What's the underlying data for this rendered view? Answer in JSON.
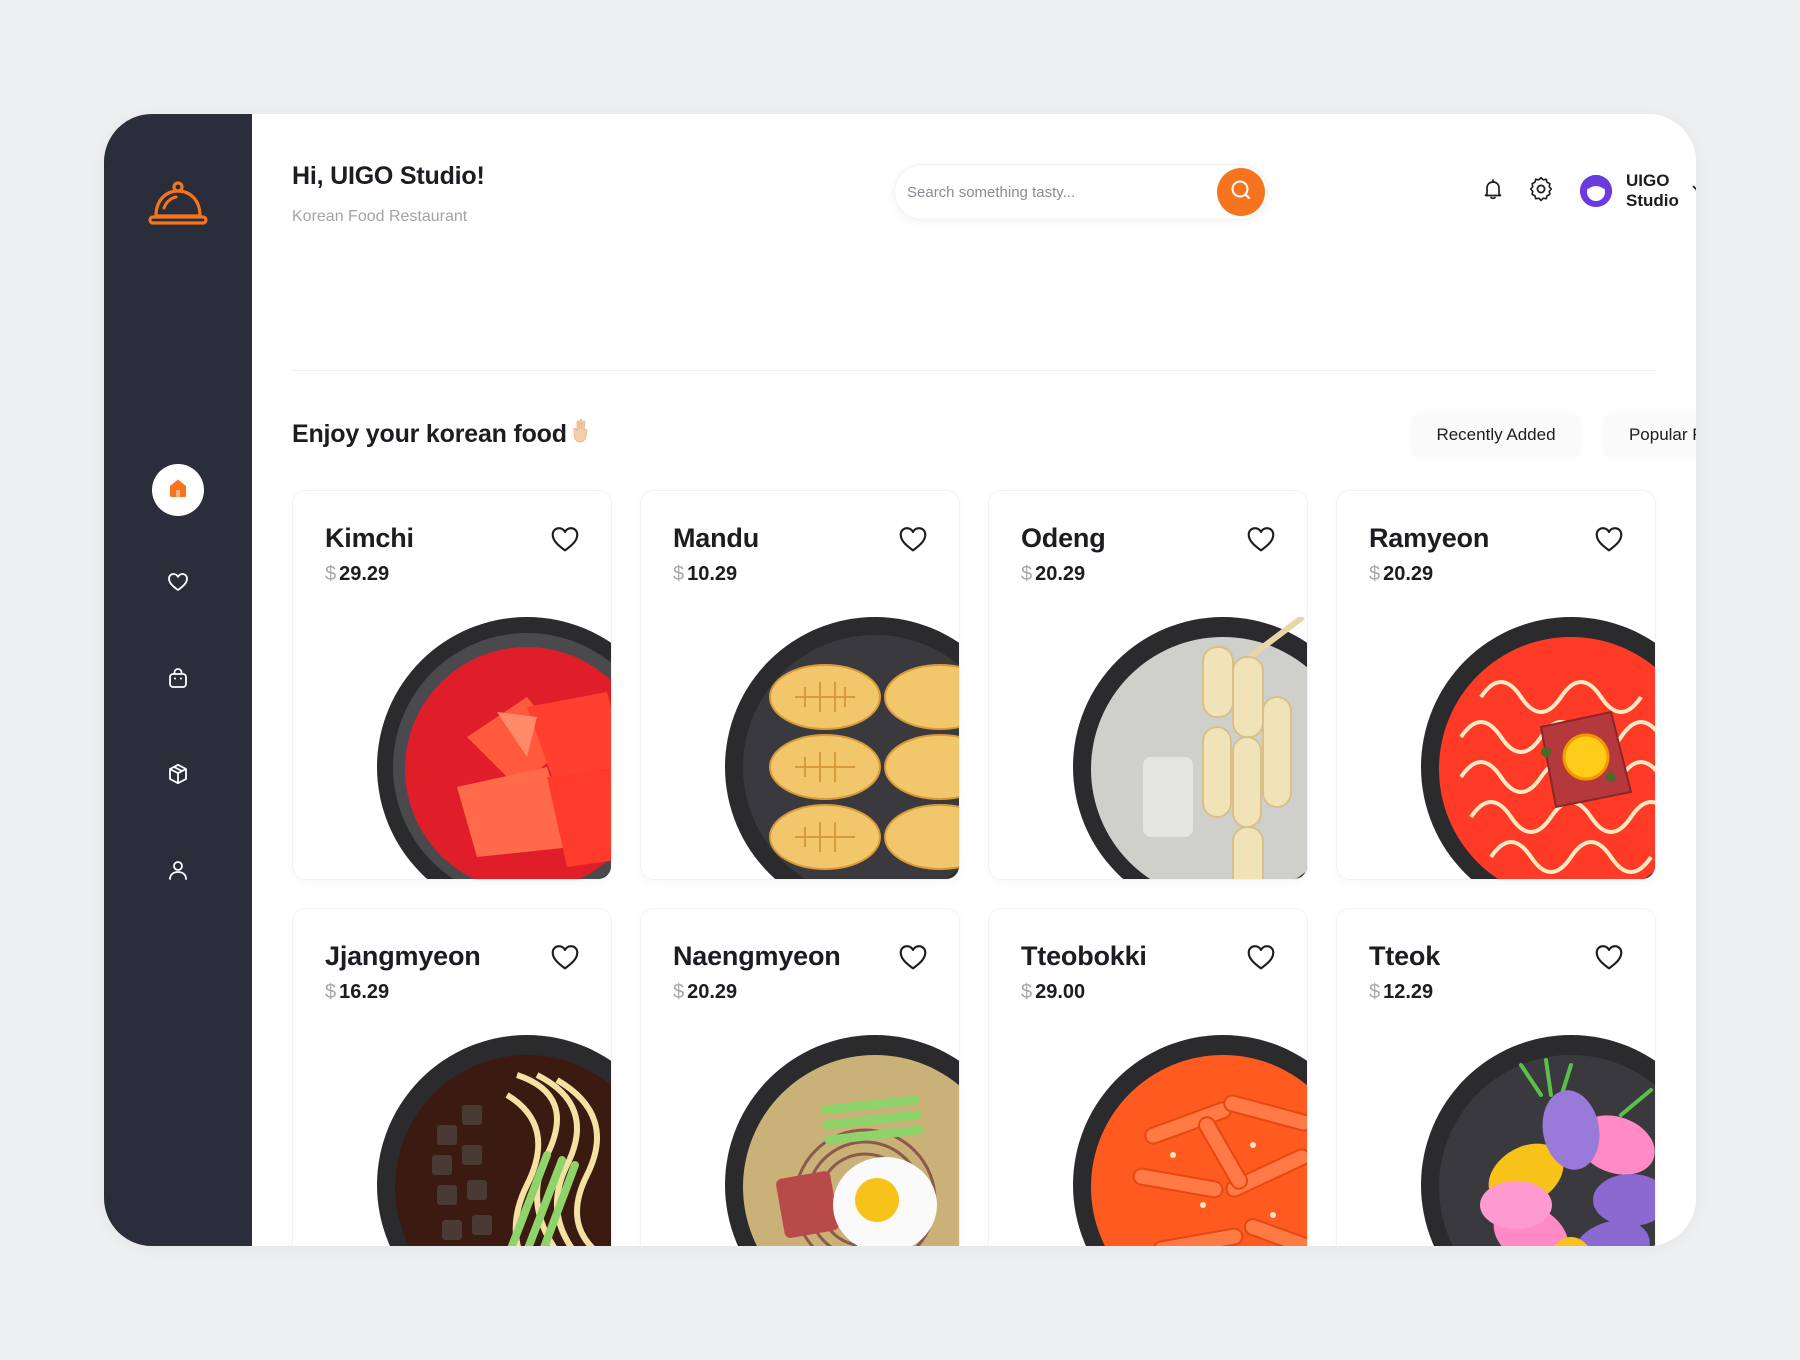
{
  "sidebar": {
    "logo": "cloche-icon",
    "items": [
      {
        "icon": "home-icon",
        "active": true
      },
      {
        "icon": "heart-icon",
        "active": false
      },
      {
        "icon": "shopping-bag-icon",
        "active": false
      },
      {
        "icon": "box-icon",
        "active": false
      },
      {
        "icon": "user-icon",
        "active": false
      }
    ]
  },
  "header": {
    "greeting": "Hi, UIGO Studio!",
    "subtitle": "Korean Food Restaurant",
    "search_placeholder": "Search something tasty...",
    "profile_name": "UIGO Studio"
  },
  "section": {
    "title": "Enjoy your korean food",
    "filters": [
      "Recently Added",
      "Popular Food"
    ]
  },
  "currency": "$",
  "foods": [
    {
      "name": "Kimchi",
      "price": "29.29",
      "dish": "kimchi"
    },
    {
      "name": "Mandu",
      "price": "10.29",
      "dish": "mandu"
    },
    {
      "name": "Odeng",
      "price": "20.29",
      "dish": "odeng"
    },
    {
      "name": "Ramyeon",
      "price": "20.29",
      "dish": "ramyeon"
    },
    {
      "name": "Jjangmyeon",
      "price": "16.29",
      "dish": "jjangmyeon"
    },
    {
      "name": "Naengmyeon",
      "price": "20.29",
      "dish": "naengmyeon"
    },
    {
      "name": "Tteobokki",
      "price": "29.00",
      "dish": "tteobokki"
    },
    {
      "name": "Tteok",
      "price": "12.29",
      "dish": "tteok"
    }
  ],
  "colors": {
    "accent": "#f7741f",
    "sidebar": "#2a2d3a",
    "avatar": "#6a3ce0"
  }
}
